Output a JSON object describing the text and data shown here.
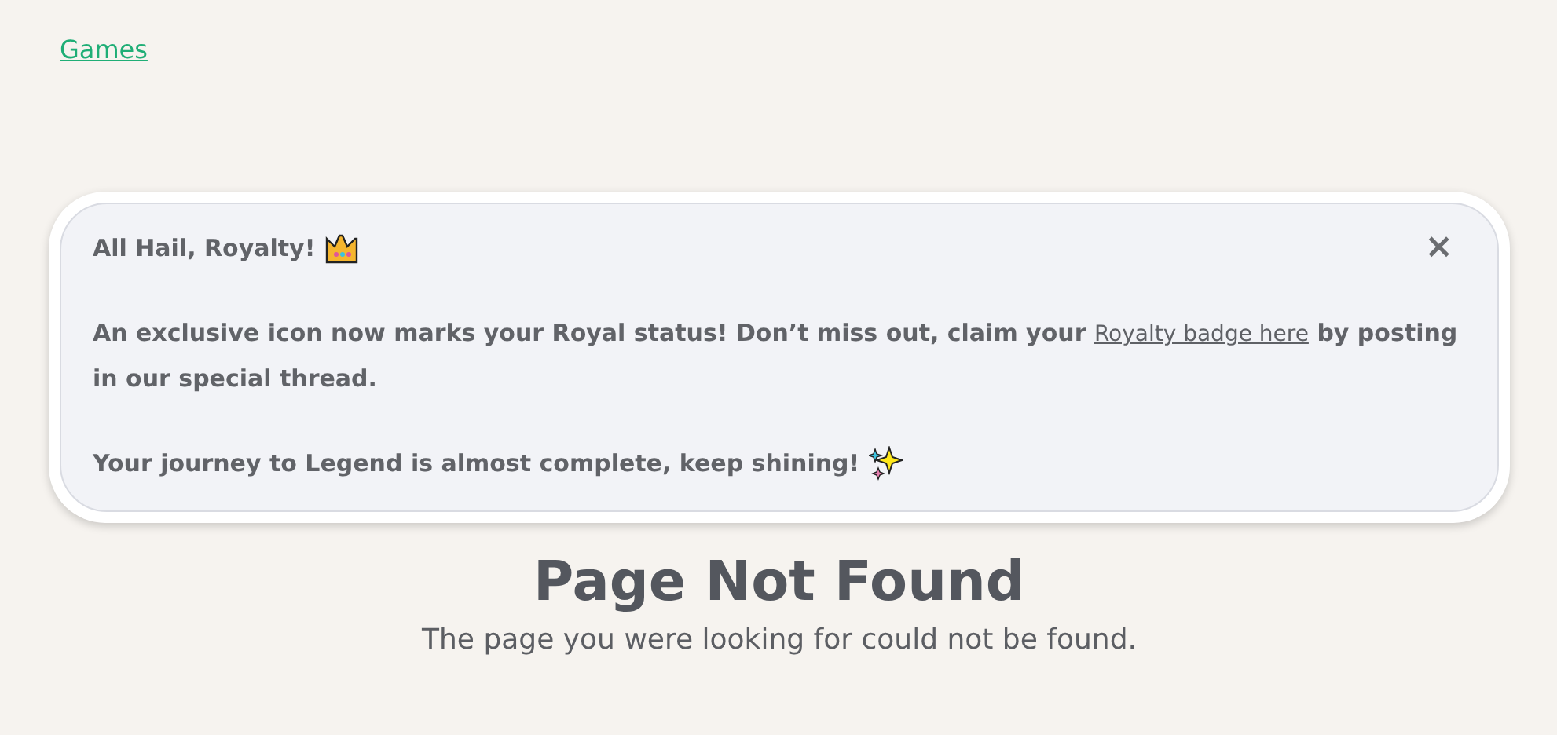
{
  "breadcrumb": {
    "label": "Games"
  },
  "notice": {
    "title": "All Hail, Royalty!",
    "close": "×",
    "message": {
      "before": "An exclusive icon now marks your Royal status! Don’t miss out, claim your",
      "link": "Royalty badge here",
      "after": "by posting in our special thread."
    },
    "footer": "Your journey to Legend is almost complete, keep shining!"
  },
  "error": {
    "heading": "Page Not Found",
    "text": "The page you were looking for could not be found."
  }
}
